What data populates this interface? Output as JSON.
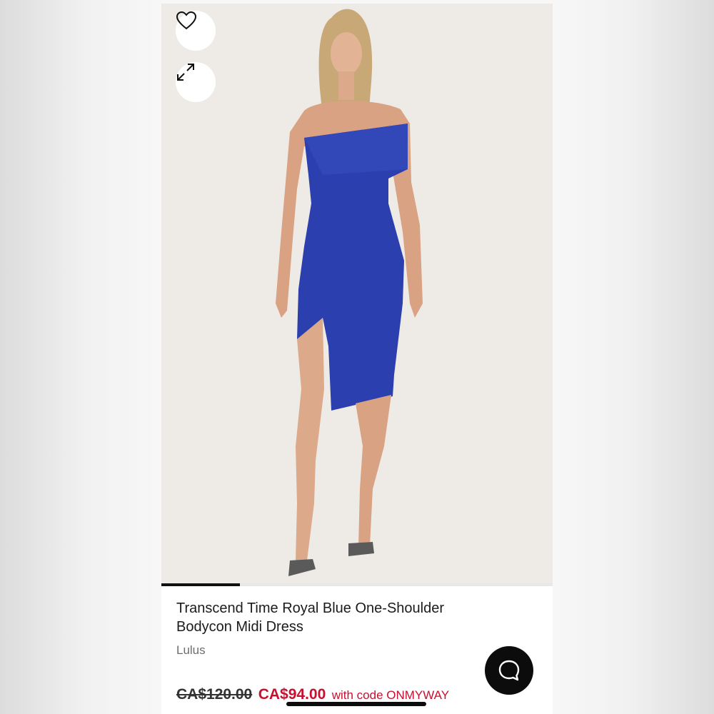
{
  "product": {
    "title_line1": "Transcend Time Royal Blue One-Shoulder",
    "title_line2": "Bodycon Midi Dress",
    "brand": "Lulus",
    "original_price": "CA$120.00",
    "sale_price": "CA$94.00",
    "promo_text": "with code ONMYWAY"
  },
  "gallery": {
    "progress": 0.2
  },
  "icons": {
    "favorite": "heart-icon",
    "expand": "expand-arrows-icon",
    "chat": "chat-bubble-icon"
  },
  "colors": {
    "sale": "#c8102e",
    "dress": "#2c3fae",
    "chat_button": "#0c0c0c"
  }
}
